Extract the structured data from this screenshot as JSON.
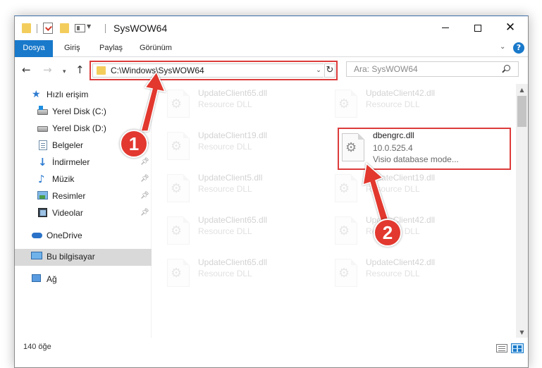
{
  "window": {
    "title": "SysWOW64"
  },
  "ribbon": {
    "tabs": [
      "Dosya",
      "Giriş",
      "Paylaş",
      "Görünüm"
    ]
  },
  "address_bar": {
    "path": "C:\\Windows\\SysWOW64",
    "search_placeholder": "Ara: SysWOW64"
  },
  "nav_pane": {
    "items": [
      {
        "label": "Hızlı erişim",
        "icon": "star-icon"
      },
      {
        "label": "Yerel Disk (C:)",
        "icon": "drive-icon"
      },
      {
        "label": "Yerel Disk (D:)",
        "icon": "drive-icon"
      },
      {
        "label": "Belgeler",
        "icon": "documents-icon"
      },
      {
        "label": "İndirmeler",
        "icon": "downloads-icon"
      },
      {
        "label": "Müzik",
        "icon": "music-icon"
      },
      {
        "label": "Resimler",
        "icon": "pictures-icon"
      },
      {
        "label": "Videolar",
        "icon": "videos-icon"
      },
      {
        "label": "OneDrive",
        "icon": "cloud-icon"
      },
      {
        "label": "Bu bilgisayar",
        "icon": "computer-icon"
      },
      {
        "label": "Ağ",
        "icon": "network-icon"
      }
    ]
  },
  "files": {
    "tiles": [
      {
        "name": "UpdateClient65.dll",
        "type": "Resource DLL"
      },
      {
        "name": "UpdateClient42.dll",
        "type": "Resource DLL"
      },
      {
        "name": "UpdateClient19.dll",
        "type": "Resource DLL"
      },
      {
        "name": "dbengrc.dll",
        "version": "10.0.525.4",
        "description": "Visio database mode..."
      },
      {
        "name": "UpdateClient5.dll",
        "type": "Resource DLL"
      },
      {
        "name": "UpdateClient19.dll",
        "type": "Resource DLL"
      },
      {
        "name": "UpdateClient65.dll",
        "type": "Resource DLL"
      },
      {
        "name": "UpdateClient42.dll",
        "type": "Resource DLL"
      },
      {
        "name": "UpdateClient65.dll",
        "type": "Resource DLL"
      },
      {
        "name": "UpdateClient42.dll",
        "type": "Resource DLL"
      }
    ]
  },
  "status_bar": {
    "item_count": "140 öğe"
  },
  "annotations": {
    "step1": "1",
    "step2": "2",
    "color": "#e2382f"
  }
}
